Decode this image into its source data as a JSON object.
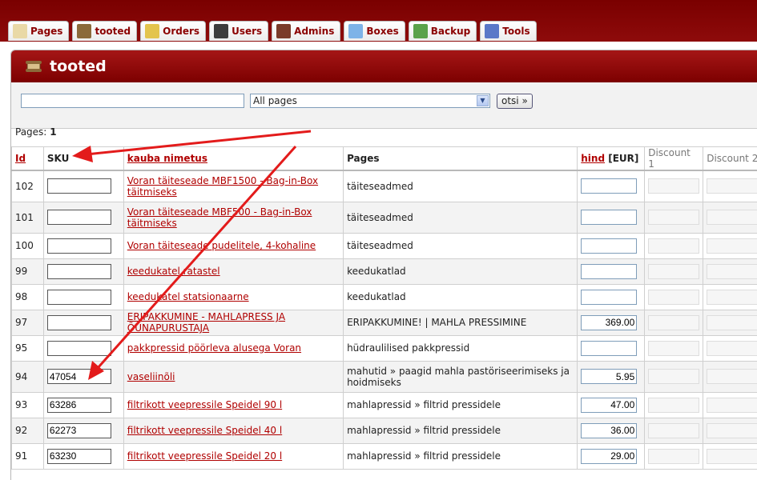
{
  "tabs": [
    {
      "label": "Pages",
      "icon": "pencil-icon",
      "color": "#e9d9a6"
    },
    {
      "label": "tooted",
      "icon": "scroll-icon",
      "color": "#8b6a3a"
    },
    {
      "label": "Orders",
      "icon": "orders-icon",
      "color": "#e3c44d"
    },
    {
      "label": "Users",
      "icon": "user-icon",
      "color": "#3d3d3d"
    },
    {
      "label": "Admins",
      "icon": "admin-icon",
      "color": "#7a3b2a"
    },
    {
      "label": "Boxes",
      "icon": "box-icon",
      "color": "#7db3e8"
    },
    {
      "label": "Backup",
      "icon": "backup-icon",
      "color": "#5aa24a"
    },
    {
      "label": "Tools",
      "icon": "gear-icon",
      "color": "#5a78c8"
    }
  ],
  "panel": {
    "title": "tooted"
  },
  "search": {
    "query": "",
    "pages_selected": "All pages",
    "button": "otsi »"
  },
  "pagination": {
    "label": "Pages:",
    "current": "1"
  },
  "columns": {
    "id": "Id",
    "sku": "SKU",
    "name": "kauba nimetus",
    "pages": "Pages",
    "price": "hind",
    "price_unit": "[EUR]",
    "discount1": "Discount 1",
    "discount2": "Discount 2"
  },
  "rows": [
    {
      "id": "102",
      "sku": "",
      "name": "Voran täiteseade MBF1500 - Bag-in-Box täitmiseks",
      "pages": "täiteseadmed",
      "price": ""
    },
    {
      "id": "101",
      "sku": "",
      "name": "Voran täiteseade MBF500 - Bag-in-Box täitmiseks",
      "pages": "täiteseadmed",
      "price": ""
    },
    {
      "id": "100",
      "sku": "",
      "name": "Voran täiteseade pudelitele, 4-kohaline",
      "pages": "täiteseadmed",
      "price": ""
    },
    {
      "id": "99",
      "sku": "",
      "name": "keedukatel ratastel",
      "pages": "keedukatlad",
      "price": ""
    },
    {
      "id": "98",
      "sku": "",
      "name": "keedukatel statsionaarne",
      "pages": "keedukatlad",
      "price": ""
    },
    {
      "id": "97",
      "sku": "",
      "name": "ERIPAKKUMINE - MAHLAPRESS JA ÕUNAPURUSTAJA",
      "pages": "ERIPAKKUMINE! | MAHLA PRESSIMINE",
      "price": "369.00"
    },
    {
      "id": "95",
      "sku": "",
      "name": "pakkpressid pöörleva alusega Voran",
      "pages": "hüdraulilised pakkpressid",
      "price": ""
    },
    {
      "id": "94",
      "sku": "47054",
      "name": "vaseliinõli",
      "pages": "mahutid » paagid mahla pastöriseerimiseks ja hoidmiseks",
      "price": "5.95"
    },
    {
      "id": "93",
      "sku": "63286",
      "name": "filtrikott veepressile Speidel 90 l",
      "pages": "mahlapressid » filtrid pressidele",
      "price": "47.00"
    },
    {
      "id": "92",
      "sku": "62273",
      "name": "filtrikott veepressile Speidel 40 l",
      "pages": "mahlapressid » filtrid pressidele",
      "price": "36.00"
    },
    {
      "id": "91",
      "sku": "63230",
      "name": "filtrikott veepressile Speidel 20 l",
      "pages": "mahlapressid » filtrid pressidele",
      "price": "29.00"
    }
  ],
  "annotation_color": "#e31b1b"
}
